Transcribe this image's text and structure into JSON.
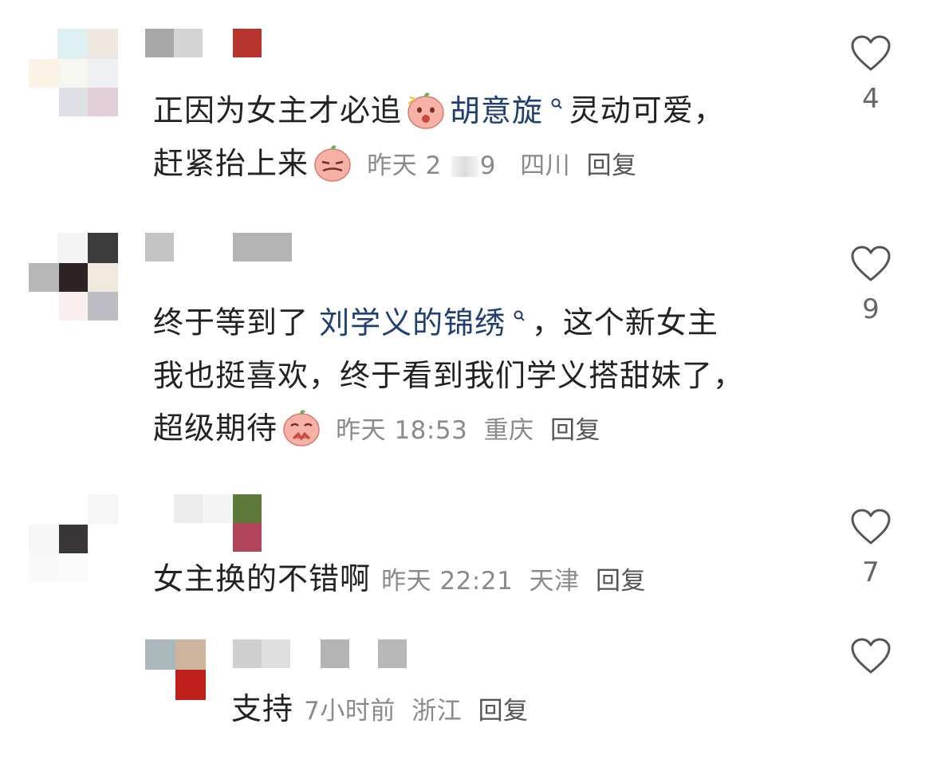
{
  "comments": [
    {
      "text_before": "正因为女主才必追",
      "mention": "胡意旋",
      "text_after_line1": "灵动可爱，",
      "text_line2": "赶紧抬上来",
      "time": "昨天 2",
      "time_tail": "9",
      "location": "四川",
      "reply": "回复",
      "likes": "4"
    },
    {
      "text_before": "终于等到了",
      "mention": "刘学义的锦绣",
      "text_after_line1": "，这个新女主",
      "text_line2": "我也挺喜欢，终于看到我们学义搭甜妹了，",
      "text_line3": "超级期待",
      "time": "昨天 18:53",
      "location": "重庆",
      "reply": "回复",
      "likes": "9"
    },
    {
      "text_line1": "女主换的不错啊",
      "time": "昨天 22:21",
      "location": "天津",
      "reply": "回复",
      "likes": "7"
    },
    {
      "text_line1": "支持",
      "time": "7小时前",
      "location": "浙江",
      "reply": "回复",
      "likes": ""
    }
  ],
  "colors": {
    "mention": "#1f3f73",
    "meta": "#8a8a8a",
    "heart_stroke": "#555555",
    "emoji_face": "#f7b2a8"
  },
  "icons": [
    "heart-outline-icon",
    "search-small-icon",
    "blush-emoji-icon",
    "smirk-emoji-icon",
    "pleading-emoji-icon"
  ]
}
